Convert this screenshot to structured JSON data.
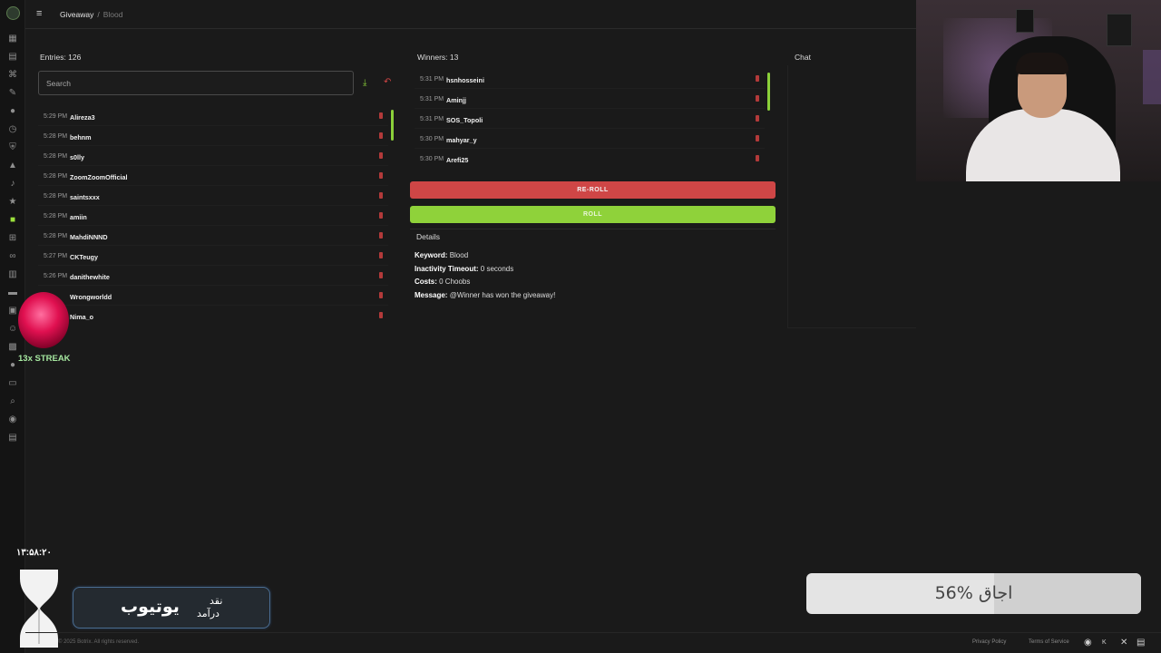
{
  "breadcrumb": {
    "section": "Giveaway",
    "current": "Blood"
  },
  "entries": {
    "title": "Entries: 126",
    "search_placeholder": "Search",
    "rows": [
      {
        "time": "5:29 PM",
        "name": "Alireza3"
      },
      {
        "time": "5:28 PM",
        "name": "behnm"
      },
      {
        "time": "5:28 PM",
        "name": "s0lly"
      },
      {
        "time": "5:28 PM",
        "name": "ZoomZoomOfficial"
      },
      {
        "time": "5:28 PM",
        "name": "saintsxxx"
      },
      {
        "time": "5:28 PM",
        "name": "amiin"
      },
      {
        "time": "5:28 PM",
        "name": "MahdiNNND"
      },
      {
        "time": "5:27 PM",
        "name": "CKTeugy"
      },
      {
        "time": "5:26 PM",
        "name": "danithewhite"
      },
      {
        "time": "",
        "name": "Wrongworldd"
      },
      {
        "time": "",
        "name": "Nima_o"
      }
    ]
  },
  "winners": {
    "title": "Winners: 13",
    "rows": [
      {
        "time": "5:31 PM",
        "name": "hsnhosseini"
      },
      {
        "time": "5:31 PM",
        "name": "Aminjj"
      },
      {
        "time": "5:31 PM",
        "name": "SOS_Topoli"
      },
      {
        "time": "5:30 PM",
        "name": "mahyar_y"
      },
      {
        "time": "5:30 PM",
        "name": "Arefi25"
      }
    ]
  },
  "buttons": {
    "reroll": "RE-ROLL",
    "roll": "ROLL"
  },
  "details": {
    "title": "Details",
    "keyword_label": "Keyword:",
    "keyword_value": "Blood",
    "inactivity_label": "Inactivity Timeout:",
    "inactivity_value": "0 seconds",
    "costs_label": "Costs:",
    "costs_value": "0 Choobs",
    "message_label": "Message:",
    "message_value": "@Winner has won the giveaway!"
  },
  "chat": {
    "title": "Chat"
  },
  "overlay": {
    "streak": "13x STREAK",
    "timer": "۱۳:۵۸:۲۰",
    "youtube_big": "یوتیوب",
    "youtube_small1": "نقد",
    "youtube_small2": "درآمد",
    "progress_label": "56% اجاق",
    "progress_fraction": 0.56
  },
  "footer": {
    "copyright": "© 2025 Botrix. All rights reserved.",
    "privacy": "Privacy Policy",
    "terms": "Terms of Service"
  },
  "colors": {
    "accent_green": "#8fd23a",
    "reroll_red": "#cf4646",
    "background": "#1a1a1a"
  }
}
